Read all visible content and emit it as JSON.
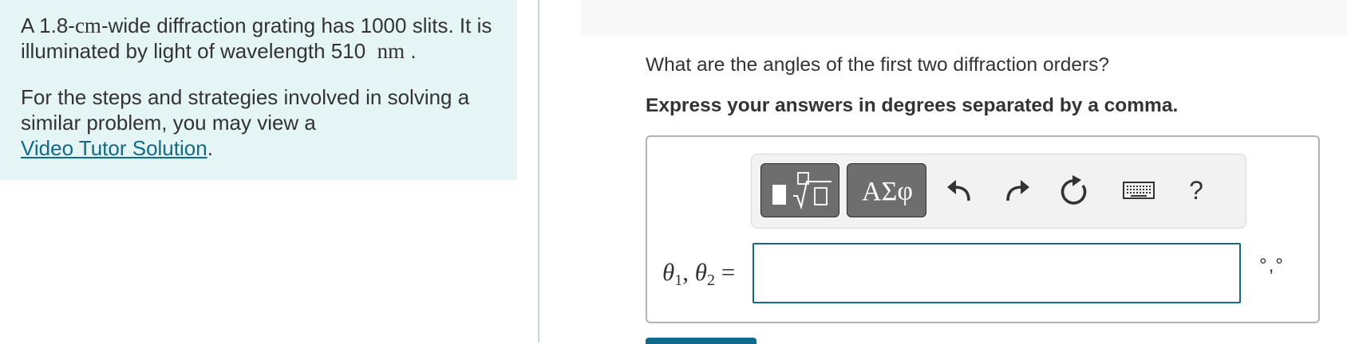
{
  "problem": {
    "line1": {
      "text_a": "A 1.8-",
      "unit_cm": "cm",
      "text_b": "-wide diffraction grating has 1000 slits. It is illuminated by light of wavelength 510",
      "unit_nm": "nm",
      "end": "."
    },
    "help_text": "For the steps and strategies involved in solving a similar problem, you may view a",
    "link_label": "Video Tutor Solution",
    "link_end": "."
  },
  "question": {
    "text": "What are the angles of the first two diffraction orders?",
    "instruction": "Express your answers in degrees separated by a comma."
  },
  "toolbar": {
    "symbols_label": "ΑΣφ",
    "help_label": "?",
    "icons": [
      "templates-icon",
      "undo-icon",
      "redo-icon",
      "reset-icon",
      "keyboard-icon",
      "help-icon"
    ]
  },
  "answer": {
    "label_theta": "θ",
    "sub1": "1",
    "comma": ", ",
    "sub2": "2",
    "equals": " =",
    "value": "",
    "unit": "°,°"
  },
  "colors": {
    "panel_bg": "#e5f5f6",
    "link": "#106a8a",
    "input_border": "#106a8a",
    "button_gray": "#6e6e6e"
  }
}
